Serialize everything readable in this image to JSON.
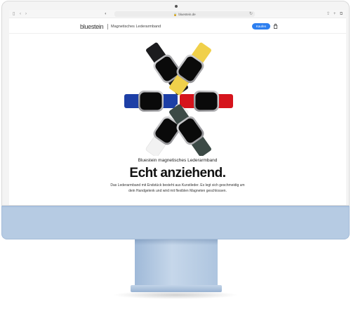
{
  "browser": {
    "url": "bluestein.de",
    "icons": [
      "sidebar-icon",
      "back-icon",
      "forward-icon",
      "privacy-shield-icon",
      "reload-icon",
      "share-icon",
      "new-tab-icon",
      "tabs-overview-icon"
    ]
  },
  "nav": {
    "logo": "bluestein",
    "product": "Magnetisches Lederarmband",
    "buy_label": "Kaufen",
    "accent": "#2d7ff0"
  },
  "hero": {
    "eyebrow": "Bluestein magnetisches Lederarmband",
    "headline": "Echt anziehend.",
    "body": "Das Lederarmband mit Endstück besteht aus Kunstleder. Es legt sich geschmeidig um dein Handgelenk und wird mit flexiblen Magneten geschlossen."
  },
  "watches": [
    {
      "color_name": "black",
      "band": "#1c1c1e"
    },
    {
      "color_name": "yellow",
      "band": "#f0d04a"
    },
    {
      "color_name": "red",
      "band": "#d6141c"
    },
    {
      "color_name": "dark-green",
      "band": "#3c4a46"
    },
    {
      "color_name": "white",
      "band": "#f2f2f2"
    },
    {
      "color_name": "blue",
      "band": "#1d3fa6"
    }
  ],
  "device": {
    "frame_color": "#b6cbe3"
  }
}
